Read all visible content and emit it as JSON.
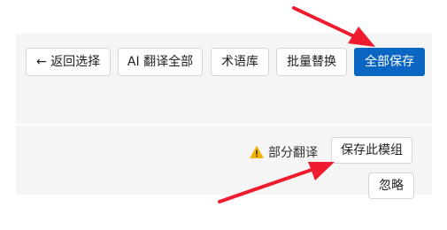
{
  "toolbar": {
    "back_label": "← 返回选择",
    "ai_translate_label": "AI 翻译全部",
    "glossary_label": "术语库",
    "batch_replace_label": "批量替换",
    "save_all_label": "全部保存"
  },
  "module_row": {
    "status_text": "部分翻译",
    "status_icon": "warning-icon",
    "save_module_label": "保存此模组",
    "ignore_label": "忽略"
  },
  "colors": {
    "primary": "#0a66c2",
    "warning": "#f4b400",
    "annotation_arrow": "#ee1c2e"
  }
}
